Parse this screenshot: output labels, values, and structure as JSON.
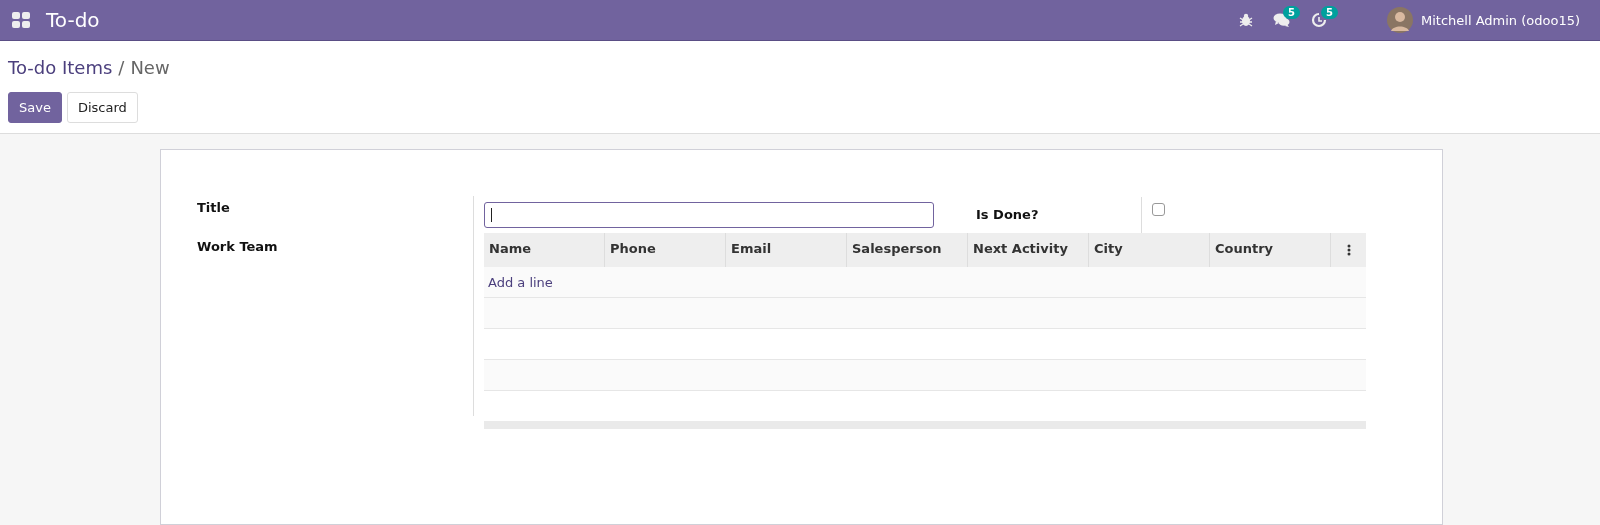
{
  "navbar": {
    "app_title": "To-do",
    "badges": [
      {
        "kind": "messages",
        "count": "5"
      },
      {
        "kind": "activities",
        "count": "5"
      }
    ],
    "user": "Mitchell Admin (odoo15)"
  },
  "breadcrumb": {
    "parent": "To-do Items",
    "separator": "/",
    "current": "New"
  },
  "buttons": [
    {
      "label": "Save",
      "kind": "primary"
    },
    {
      "label": "Discard",
      "kind": "secondary"
    }
  ],
  "form": {
    "title_label": "Title",
    "work_team_label": "Work Team",
    "is_done": {
      "label": "Is Done?",
      "checked": false
    },
    "table": {
      "columns": [
        "Name",
        "Phone",
        "Email",
        "Salesperson",
        "Next Activity",
        "City",
        "Country"
      ],
      "add_line": "Add a line"
    }
  }
}
